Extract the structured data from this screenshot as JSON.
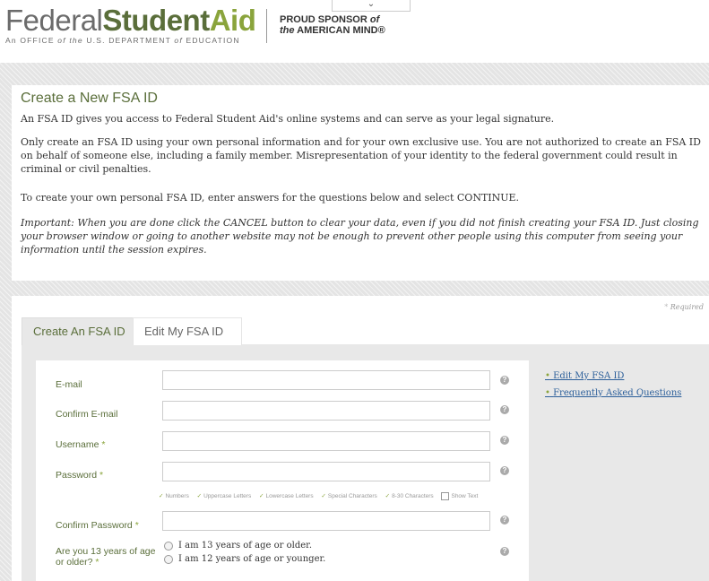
{
  "header": {
    "logo_word1": "Federal",
    "logo_word2": "Student",
    "logo_word3": "Aid",
    "logo_sub_1": "An OFFICE ",
    "logo_sub_2": "of the",
    "logo_sub_3": " U.S. DEPARTMENT ",
    "logo_sub_4": "of",
    "logo_sub_5": " EDUCATION",
    "sponsor_line1_a": "PROUD SPONSOR ",
    "sponsor_line1_b": "of",
    "sponsor_line2_a": "the",
    "sponsor_line2_b": " AMERICAN MIND",
    "sponsor_reg": "®",
    "dropdown_icon": "chevron-down-icon",
    "dropdown_glyph": "⌄"
  },
  "intro": {
    "title": "Create a New FSA ID",
    "p1": "An FSA ID gives you access to Federal Student Aid's online systems and can serve as your legal signature.",
    "p2": "Only create an FSA ID using your own personal information and for your own exclusive use. You are not authorized to create an FSA ID on behalf of someone else, including a family member. Misrepresentation of your identity to the federal government could result in criminal or civil penalties.",
    "p3": "To create your own personal FSA ID, enter answers for the questions below and select CONTINUE.",
    "p4": "Important: When you are done click the CANCEL button to clear your data, even if you did not finish creating your FSA ID. Just closing your browser window or going to another website may not be enough to prevent other people using this computer from seeing your information until the session expires."
  },
  "form": {
    "required_star": "*",
    "required_label": " Required",
    "tabs": [
      {
        "label": "Create An FSA ID",
        "active": true
      },
      {
        "label": "Edit My FSA ID",
        "active": false
      }
    ],
    "side_links": [
      {
        "bullet": "•",
        "label": "Edit My FSA ID"
      },
      {
        "bullet": "•",
        "label": "Frequently Asked Questions"
      }
    ],
    "fields": {
      "email": {
        "label": "E-mail",
        "value": ""
      },
      "confirm_email": {
        "label": "Confirm E-mail",
        "value": ""
      },
      "username": {
        "label": "Username",
        "req": " *",
        "value": ""
      },
      "password": {
        "label": "Password",
        "req": " *",
        "value": ""
      },
      "confirm_password": {
        "label": "Confirm Password",
        "req": " *",
        "value": ""
      }
    },
    "help_glyph": "?",
    "password_hints": {
      "check": "✓",
      "items": [
        "Numbers",
        "Uppercase Letters",
        "Lowercase Letters",
        "Special Characters",
        "8-30 Characters"
      ],
      "show_text": "Show Text"
    },
    "age_question": {
      "label_line1": "Are you 13 years of age",
      "label_line2": "or older?",
      "req": " *",
      "options": [
        "I am 13 years of age or older.",
        "I am 12 years of age or younger."
      ]
    }
  },
  "colors": {
    "brand_green": "#5a6e3a",
    "accent_green": "#8aa43c",
    "link_blue": "#2c5f9a"
  }
}
